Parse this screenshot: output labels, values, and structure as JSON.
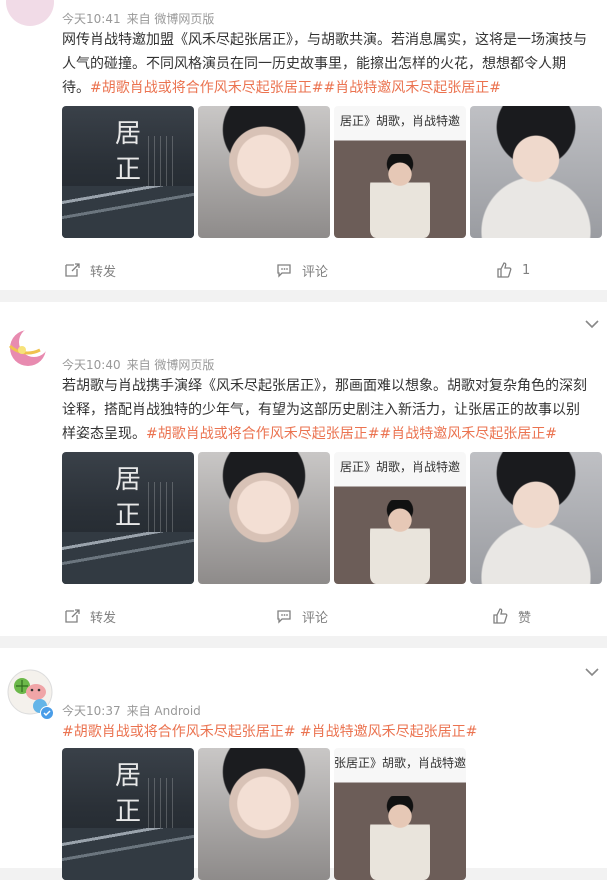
{
  "posts": [
    {
      "time": "今天10:41",
      "source": "来自 微博网页版",
      "text": "网传肖战特邀加盟《风禾尽起张居正》，与胡歌共演。若消息属实，这将是一场演技与人气的碰撞。不同风格演员在同一历史故事里，能擦出怎样的火花，想想都令人期待。",
      "tags": "#胡歌肖战或将合作风禾尽起张居正##肖战特邀风禾尽起张居正#",
      "still_caption": "居正》胡歌，肖战特邀",
      "poster_chars": "居正",
      "repost": "转发",
      "comment": "评论",
      "like": "1"
    },
    {
      "time": "今天10:40",
      "source": "来自 微博网页版",
      "text": "若胡歌与肖战携手演绎《风禾尽起张居正》，那画面难以想象。胡歌对复杂角色的深刻诠释，搭配肖战独特的少年气，有望为这部历史剧注入新活力，让张居正的故事以别样姿态呈现。",
      "tags": "#胡歌肖战或将合作风禾尽起张居正##肖战特邀风禾尽起张居正#",
      "still_caption": "居正》胡歌，肖战特邀",
      "poster_chars": "居正",
      "repost": "转发",
      "comment": "评论",
      "like": "赞"
    },
    {
      "time": "今天10:37",
      "source": "来自 Android",
      "tags": "#胡歌肖战或将合作风禾尽起张居正# #肖战特邀风禾尽起张居正#",
      "still_caption": "张居正》胡歌，肖战特邀",
      "poster_chars": "居正"
    }
  ]
}
